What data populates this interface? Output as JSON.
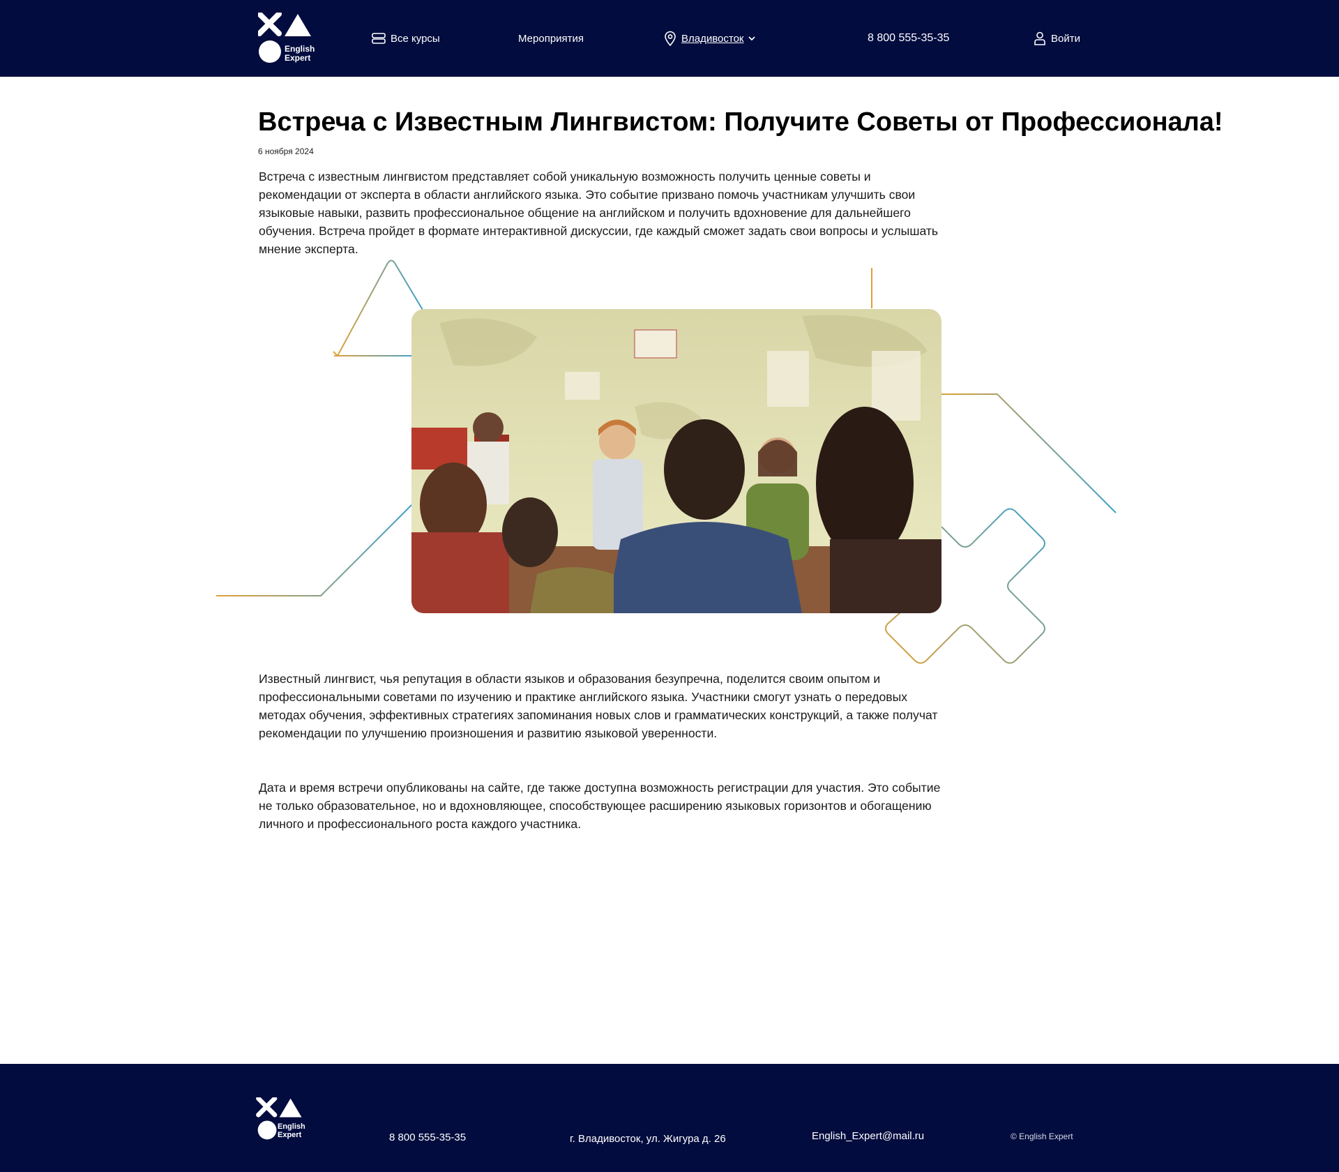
{
  "colors": {
    "brand_navy": "#020c3e",
    "accent_orange": "#e0a03a",
    "accent_blue": "#3aa0c8"
  },
  "header": {
    "logo_text": "English Expert",
    "nav": {
      "courses_label": "Все курсы",
      "events_label": "Мероприятия",
      "city_label": "Владивосток",
      "phone": "8 800 555-35-35",
      "login_label": "Войти"
    },
    "icons": {
      "courses": "layers-icon",
      "city": "map-pin-icon",
      "city_dropdown": "chevron-down-icon",
      "login": "user-icon"
    }
  },
  "article": {
    "title": "Встреча с Известным Лингвистом: Получите Советы от Профессионала!",
    "date": "6 ноября 2024",
    "paragraphs": [
      "Встреча с известным лингвистом представляет собой уникальную возможность получить ценные советы и рекомендации от эксперта в области английского языка. Это событие призвано помочь участникам улучшить свои языковые навыки, развить профессиональное общение на английском и получить вдохновение для дальнейшего обучения. Встреча пройдет в формате интерактивной дискуссии, где каждый сможет задать свои вопросы и услышать мнение эксперта.",
      "Известный лингвист, чья репутация в области языков и образования безупречна, поделится своим опытом и профессиональными советами по изучению и практике английского языка. Участники смогут узнать о передовых методах обучения, эффективных стратегиях запоминания новых слов и грамматических конструкций, а также получат рекомендации по улучшению произношения и развитию языковой уверенности.",
      "Дата и время встречи опубликованы на сайте, где также доступна возможность регистрации для участия. Это событие не только образовательное, но и вдохновляющее, способствующее расширению языковых горизонтов и обогащению личного и профессионального роста каждого участника."
    ]
  },
  "footer": {
    "logo_text": "English Expert",
    "phone": "8 800 555-35-35",
    "address": "г. Владивосток, ул. Жигура д. 26",
    "email": "English_Expert@mail.ru",
    "copyright": "© English Expert"
  }
}
